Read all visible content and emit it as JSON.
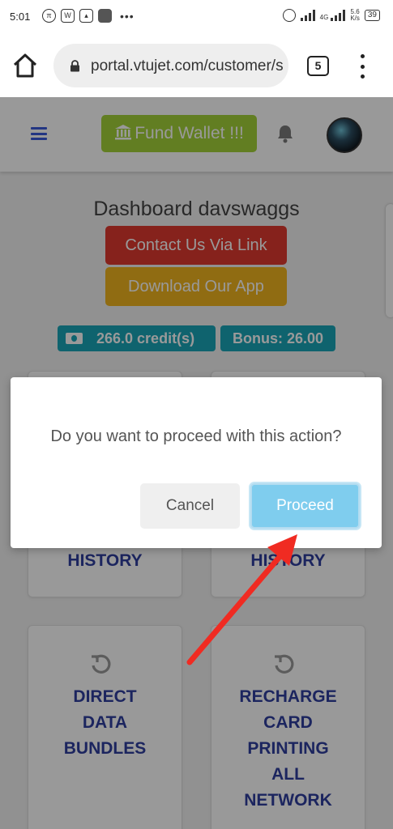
{
  "status_bar": {
    "time": "5:01",
    "left_icons": [
      "pi-icon",
      "word-icon",
      "image-icon",
      "app-icon"
    ],
    "overflow_dots": "•••",
    "net_type": "4G",
    "net_speed_top": "5.6",
    "net_speed_bottom": "K/s",
    "battery": "39"
  },
  "browser": {
    "url": "portal.vtujet.com/customer/s",
    "tab_count": "5"
  },
  "header": {
    "fund_wallet_label": "Fund Wallet !!!"
  },
  "dashboard": {
    "title": "Dashboard davswaggs",
    "contact_label": "Contact Us Via Link",
    "download_label": "Download Our App",
    "credit_label": "266.0 credit(s)",
    "bonus_label": "Bonus: 26.00"
  },
  "cards": [
    {
      "label_lines": [
        "HISTORY"
      ]
    },
    {
      "label_lines": [
        "HISTORY"
      ]
    },
    {
      "label_lines": [
        "DIRECT",
        "DATA",
        "BUNDLES"
      ]
    },
    {
      "label_lines": [
        "RECHARGE",
        "CARD",
        "PRINTING",
        "ALL",
        "NETWORK"
      ]
    }
  ],
  "dialog": {
    "message": "Do you want to proceed with this action?",
    "cancel_label": "Cancel",
    "proceed_label": "Proceed"
  },
  "colors": {
    "accent_blue": "#3b5bdb",
    "fund_green": "#a4d23a",
    "contact_red": "#e03a2f",
    "download_yellow": "#f0b51f",
    "badge_teal": "#1aa6b7",
    "proceed_blue": "#7fcdee",
    "annotation_arrow": "#f02b22"
  }
}
